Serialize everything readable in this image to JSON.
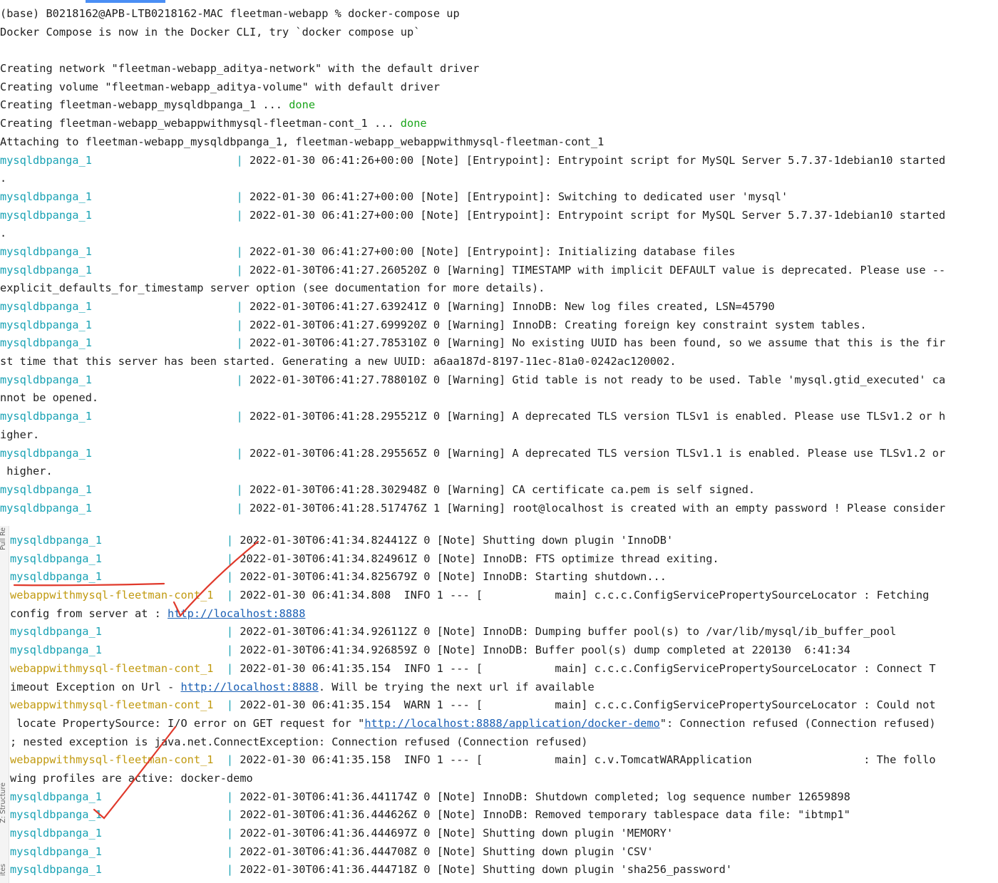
{
  "terminal_top": [
    {
      "t": "(base) B0218162@APB-LTB0218162-MAC fleetman-webapp % docker-compose up"
    },
    {
      "t": "Docker Compose is now in the Docker CLI, try `docker compose up`"
    },
    {
      "t": ""
    },
    {
      "t": "Creating network \"fleetman-webapp_aditya-network\" with the default driver"
    },
    {
      "t": "Creating volume \"fleetman-webapp_aditya-volume\" with default driver"
    },
    {
      "t": "Creating fleetman-webapp_mysqldbpanga_1 ... ",
      "status": "done"
    },
    {
      "t": "Creating fleetman-webapp_webappwithmysql-fleetman-cont_1 ... ",
      "status": "done"
    },
    {
      "t": "Attaching to fleetman-webapp_mysqldbpanga_1, fleetman-webapp_webappwithmysql-fleetman-cont_1"
    },
    {
      "svc": "mysqldbpanga_1",
      "kind": "db",
      "msg": "2022-01-30 06:41:26+00:00 [Note] [Entrypoint]: Entrypoint script for MySQL Server 5.7.37-1debian10 started"
    },
    {
      "t": "."
    },
    {
      "svc": "mysqldbpanga_1",
      "kind": "db",
      "msg": "2022-01-30 06:41:27+00:00 [Note] [Entrypoint]: Switching to dedicated user 'mysql'"
    },
    {
      "svc": "mysqldbpanga_1",
      "kind": "db",
      "msg": "2022-01-30 06:41:27+00:00 [Note] [Entrypoint]: Entrypoint script for MySQL Server 5.7.37-1debian10 started"
    },
    {
      "t": "."
    },
    {
      "svc": "mysqldbpanga_1",
      "kind": "db",
      "msg": "2022-01-30 06:41:27+00:00 [Note] [Entrypoint]: Initializing database files"
    },
    {
      "svc": "mysqldbpanga_1",
      "kind": "db",
      "msg": "2022-01-30T06:41:27.260520Z 0 [Warning] TIMESTAMP with implicit DEFAULT value is deprecated. Please use --"
    },
    {
      "t": "explicit_defaults_for_timestamp server option (see documentation for more details)."
    },
    {
      "svc": "mysqldbpanga_1",
      "kind": "db",
      "msg": "2022-01-30T06:41:27.639241Z 0 [Warning] InnoDB: New log files created, LSN=45790"
    },
    {
      "svc": "mysqldbpanga_1",
      "kind": "db",
      "msg": "2022-01-30T06:41:27.699920Z 0 [Warning] InnoDB: Creating foreign key constraint system tables."
    },
    {
      "svc": "mysqldbpanga_1",
      "kind": "db",
      "msg": "2022-01-30T06:41:27.785310Z 0 [Warning] No existing UUID has been found, so we assume that this is the fir"
    },
    {
      "t": "st time that this server has been started. Generating a new UUID: a6aa187d-8197-11ec-81a0-0242ac120002."
    },
    {
      "svc": "mysqldbpanga_1",
      "kind": "db",
      "msg": "2022-01-30T06:41:27.788010Z 0 [Warning] Gtid table is not ready to be used. Table 'mysql.gtid_executed' ca"
    },
    {
      "t": "nnot be opened."
    },
    {
      "svc": "mysqldbpanga_1",
      "kind": "db",
      "msg": "2022-01-30T06:41:28.295521Z 0 [Warning] A deprecated TLS version TLSv1 is enabled. Please use TLSv1.2 or h"
    },
    {
      "t": "igher."
    },
    {
      "svc": "mysqldbpanga_1",
      "kind": "db",
      "msg": "2022-01-30T06:41:28.295565Z 0 [Warning] A deprecated TLS version TLSv1.1 is enabled. Please use TLSv1.2 or"
    },
    {
      "t": " higher."
    },
    {
      "svc": "mysqldbpanga_1",
      "kind": "db",
      "msg": "2022-01-30T06:41:28.302948Z 0 [Warning] CA certificate ca.pem is self signed."
    },
    {
      "svc": "mysqldbpanga_1",
      "kind": "db",
      "msg": "2022-01-30T06:41:28.517476Z 1 [Warning] root@localhost is created with an empty password ! Please consider"
    }
  ],
  "terminal_bottom": [
    {
      "svc": "mysqldbpanga_1",
      "kind": "db",
      "msg": "2022-01-30T06:41:34.824412Z 0 [Note] Shutting down plugin 'InnoDB'"
    },
    {
      "svc": "mysqldbpanga_1",
      "kind": "db",
      "msg": "2022-01-30T06:41:34.824961Z 0 [Note] InnoDB: FTS optimize thread exiting."
    },
    {
      "svc": "mysqldbpanga_1",
      "kind": "db",
      "msg": "2022-01-30T06:41:34.825679Z 0 [Note] InnoDB: Starting shutdown..."
    },
    {
      "svc": "webappwithmysql-fleetman-cont_1",
      "kind": "web",
      "msg": "2022-01-30 06:41:34.808  INFO 1 --- [           main] c.c.c.ConfigServicePropertySourceLocator : Fetching"
    },
    {
      "segs": [
        {
          "t": "config from server at : "
        },
        {
          "t": "http://localhost:8888",
          "link": true
        }
      ]
    },
    {
      "svc": "mysqldbpanga_1",
      "kind": "db",
      "msg": "2022-01-30T06:41:34.926112Z 0 [Note] InnoDB: Dumping buffer pool(s) to /var/lib/mysql/ib_buffer_pool"
    },
    {
      "svc": "mysqldbpanga_1",
      "kind": "db",
      "msg": "2022-01-30T06:41:34.926859Z 0 [Note] InnoDB: Buffer pool(s) dump completed at 220130  6:41:34"
    },
    {
      "svc": "webappwithmysql-fleetman-cont_1",
      "kind": "web",
      "msg": "2022-01-30 06:41:35.154  INFO 1 --- [           main] c.c.c.ConfigServicePropertySourceLocator : Connect T"
    },
    {
      "segs": [
        {
          "t": "imeout Exception on Url - "
        },
        {
          "t": "http://localhost:8888",
          "link": true
        },
        {
          "t": ". Will be trying the next url if available"
        }
      ]
    },
    {
      "svc": "webappwithmysql-fleetman-cont_1",
      "kind": "web",
      "msg": "2022-01-30 06:41:35.154  WARN 1 --- [           main] c.c.c.ConfigServicePropertySourceLocator : Could not"
    },
    {
      "segs": [
        {
          "t": " locate PropertySource: I/O error on GET request for \""
        },
        {
          "t": "http://localhost:8888/application/docker-demo",
          "link": true
        },
        {
          "t": "\": Connection refused (Connection refused)"
        }
      ]
    },
    {
      "t": "; nested exception is java.net.ConnectException: Connection refused (Connection refused)"
    },
    {
      "svc": "webappwithmysql-fleetman-cont_1",
      "kind": "web",
      "msg": "2022-01-30 06:41:35.158  INFO 1 --- [           main] c.v.TomcatWARApplication                 : The follo"
    },
    {
      "t": "wing profiles are active: docker-demo"
    },
    {
      "svc": "mysqldbpanga_1",
      "kind": "db",
      "msg": "2022-01-30T06:41:36.441174Z 0 [Note] InnoDB: Shutdown completed; log sequence number 12659898"
    },
    {
      "svc": "mysqldbpanga_1",
      "kind": "db",
      "msg": "2022-01-30T06:41:36.444626Z 0 [Note] InnoDB: Removed temporary tablespace data file: \"ibtmp1\""
    },
    {
      "svc": "mysqldbpanga_1",
      "kind": "db",
      "msg": "2022-01-30T06:41:36.444697Z 0 [Note] Shutting down plugin 'MEMORY'"
    },
    {
      "svc": "mysqldbpanga_1",
      "kind": "db",
      "msg": "2022-01-30T06:41:36.444708Z 0 [Note] Shutting down plugin 'CSV'"
    },
    {
      "svc": "mysqldbpanga_1",
      "kind": "db",
      "msg": "2022-01-30T06:41:36.444718Z 0 [Note] Shutting down plugin 'sha256_password'"
    }
  ],
  "side_tabs": {
    "pull_requests": "Pull Re",
    "structure": "Z: Structure",
    "favorites": "ites"
  },
  "colors": {
    "db_service": "#19a2b4",
    "web_service": "#c19a10",
    "done": "#1aa51a",
    "link": "#1a5fb4",
    "annotation": "#e0392b",
    "accent": "#4a8ef5"
  }
}
